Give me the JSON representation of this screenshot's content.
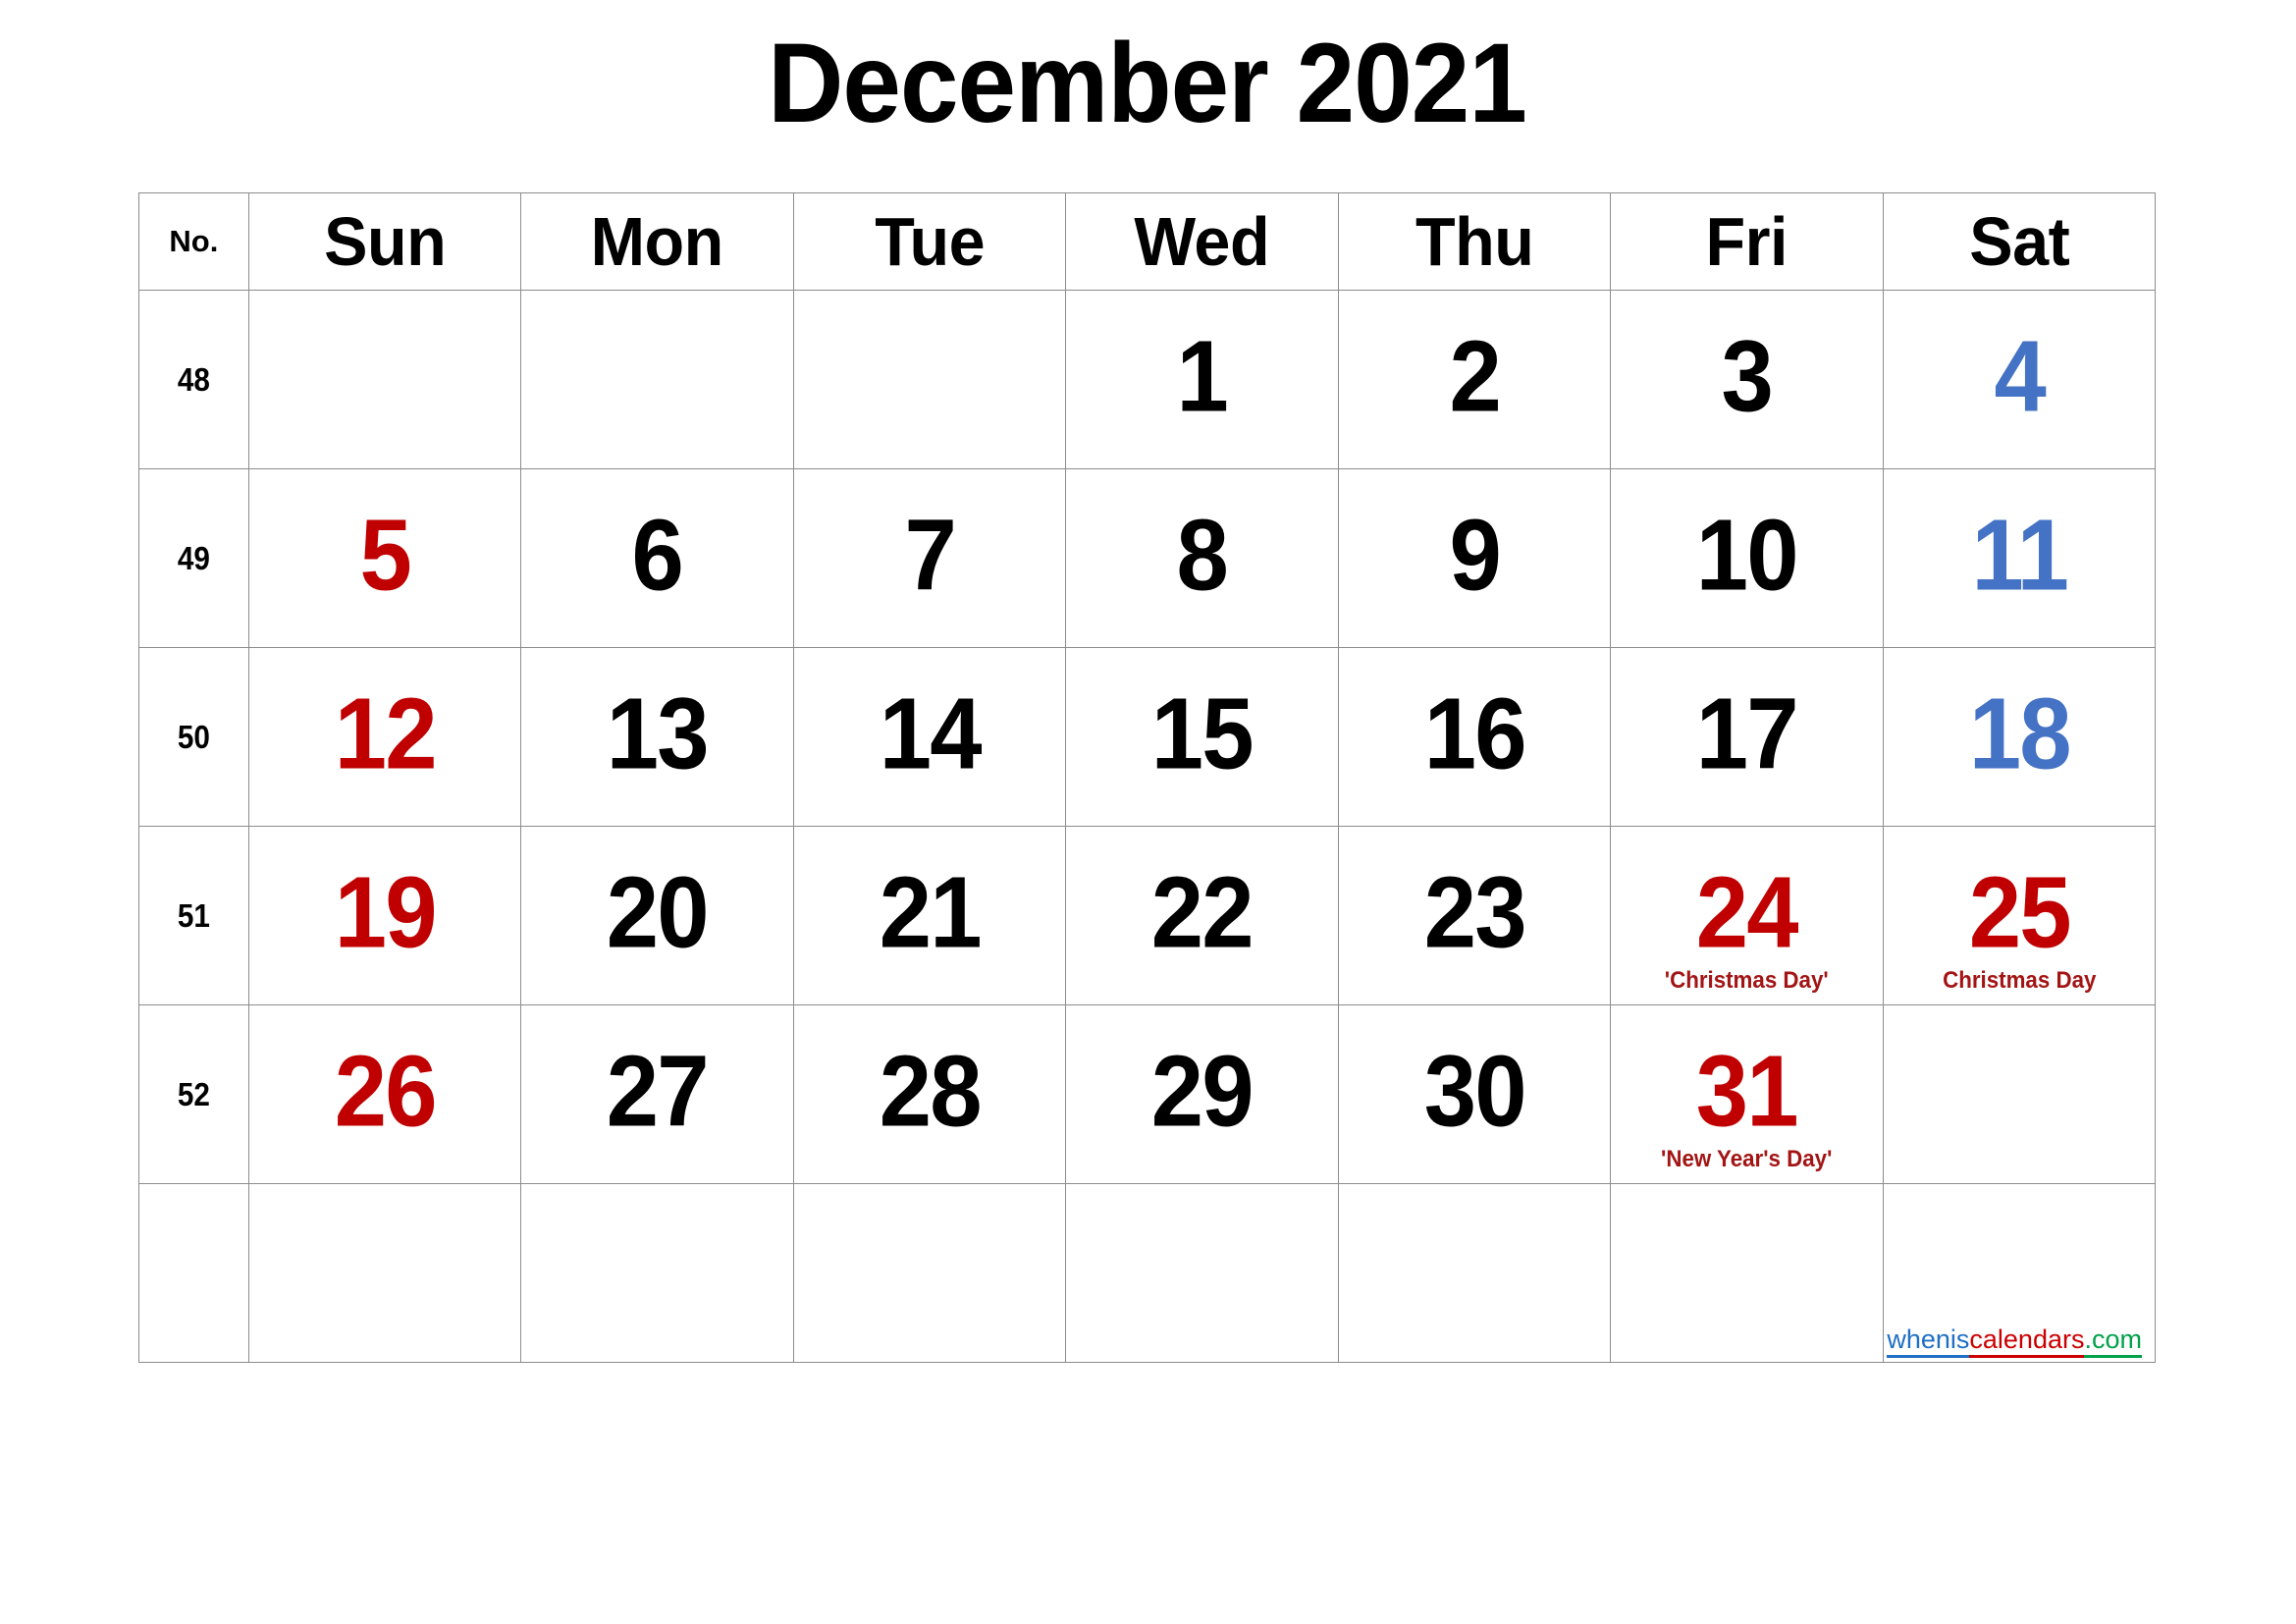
{
  "title": "December 2021",
  "colors": {
    "sunday": "#C00000",
    "saturday": "#4472C4",
    "holiday": "#C00000",
    "holiday_label": "#A31515",
    "weekday": "#000000",
    "grid_border": "#8C8C8C",
    "watermark_blue": "#1F6FC4",
    "watermark_red": "#CC0000",
    "watermark_green": "#00A14B"
  },
  "header": {
    "week_no_label": "No.",
    "days": [
      "Sun",
      "Mon",
      "Tue",
      "Wed",
      "Thu",
      "Fri",
      "Sat"
    ]
  },
  "weeks": [
    {
      "no": "48",
      "days": [
        {
          "num": "",
          "style": "empty",
          "note": ""
        },
        {
          "num": "",
          "style": "empty",
          "note": ""
        },
        {
          "num": "",
          "style": "empty",
          "note": ""
        },
        {
          "num": "1",
          "style": "weekday",
          "note": ""
        },
        {
          "num": "2",
          "style": "weekday",
          "note": ""
        },
        {
          "num": "3",
          "style": "weekday",
          "note": ""
        },
        {
          "num": "4",
          "style": "saturday",
          "note": ""
        }
      ]
    },
    {
      "no": "49",
      "days": [
        {
          "num": "5",
          "style": "sunday",
          "note": ""
        },
        {
          "num": "6",
          "style": "weekday",
          "note": ""
        },
        {
          "num": "7",
          "style": "weekday",
          "note": ""
        },
        {
          "num": "8",
          "style": "weekday",
          "note": ""
        },
        {
          "num": "9",
          "style": "weekday",
          "note": ""
        },
        {
          "num": "10",
          "style": "weekday",
          "note": ""
        },
        {
          "num": "11",
          "style": "saturday",
          "note": ""
        }
      ]
    },
    {
      "no": "50",
      "days": [
        {
          "num": "12",
          "style": "sunday",
          "note": ""
        },
        {
          "num": "13",
          "style": "weekday",
          "note": ""
        },
        {
          "num": "14",
          "style": "weekday",
          "note": ""
        },
        {
          "num": "15",
          "style": "weekday",
          "note": ""
        },
        {
          "num": "16",
          "style": "weekday",
          "note": ""
        },
        {
          "num": "17",
          "style": "weekday",
          "note": ""
        },
        {
          "num": "18",
          "style": "saturday",
          "note": ""
        }
      ]
    },
    {
      "no": "51",
      "days": [
        {
          "num": "19",
          "style": "sunday",
          "note": ""
        },
        {
          "num": "20",
          "style": "weekday",
          "note": ""
        },
        {
          "num": "21",
          "style": "weekday",
          "note": ""
        },
        {
          "num": "22",
          "style": "weekday",
          "note": ""
        },
        {
          "num": "23",
          "style": "weekday",
          "note": ""
        },
        {
          "num": "24",
          "style": "holiday",
          "note": "'Christmas Day'"
        },
        {
          "num": "25",
          "style": "holiday",
          "note": "Christmas Day"
        }
      ]
    },
    {
      "no": "52",
      "days": [
        {
          "num": "26",
          "style": "sunday",
          "note": ""
        },
        {
          "num": "27",
          "style": "weekday",
          "note": ""
        },
        {
          "num": "28",
          "style": "weekday",
          "note": ""
        },
        {
          "num": "29",
          "style": "weekday",
          "note": ""
        },
        {
          "num": "30",
          "style": "weekday",
          "note": ""
        },
        {
          "num": "31",
          "style": "holiday",
          "note": "'New Year's Day'"
        },
        {
          "num": "",
          "style": "empty",
          "note": ""
        }
      ]
    },
    {
      "no": "",
      "days": [
        {
          "num": "",
          "style": "empty",
          "note": ""
        },
        {
          "num": "",
          "style": "empty",
          "note": ""
        },
        {
          "num": "",
          "style": "empty",
          "note": ""
        },
        {
          "num": "",
          "style": "empty",
          "note": ""
        },
        {
          "num": "",
          "style": "empty",
          "note": ""
        },
        {
          "num": "",
          "style": "empty",
          "note": ""
        },
        {
          "num": "",
          "style": "empty",
          "note": ""
        }
      ]
    }
  ],
  "watermark": {
    "part1": "whenis",
    "part2": "calendars",
    "part3": ".com"
  }
}
